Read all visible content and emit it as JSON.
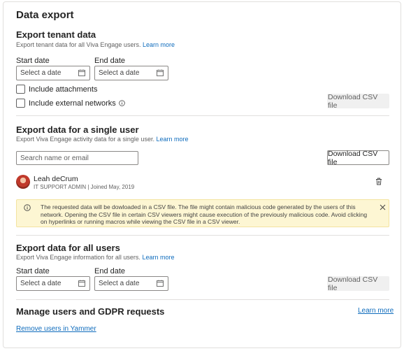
{
  "page": {
    "title": "Data export"
  },
  "tenant": {
    "heading": "Export tenant data",
    "description": "Export tenant data for all Viva Engage users.",
    "learn_more": "Learn more",
    "start_label": "Start date",
    "end_label": "End date",
    "start_placeholder": "Select a date",
    "end_placeholder": "Select a date",
    "include_attachments": "Include attachments",
    "include_external": "Include external networks",
    "download": "Download CSV file"
  },
  "single_user": {
    "heading": "Export data for a single user",
    "description": "Export Viva Engage activity data for a single user.",
    "learn_more": "Learn more",
    "search_placeholder": "Search name or email",
    "download": "Download CSV file",
    "user": {
      "name": "Leah deCrum",
      "meta": "IT SUPPORT ADMIN | Joined May, 2019"
    }
  },
  "warning": {
    "text": "The requested data will be dowloaded in a CSV file. The file might contain malicious code generated by the users of this network. Opening the CSV file in certain CSV viewers might cause execution of the previously malicious code. Avoid clicking on hyperlinks or running macros while viewing the CSV file in a CSV viewer."
  },
  "all_users": {
    "heading": "Export data for all users",
    "description": "Export Viva Engage information for all users.",
    "learn_more": "Learn more",
    "start_label": "Start date",
    "end_label": "End date",
    "start_placeholder": "Select a date",
    "end_placeholder": "Select a date",
    "download": "Download CSV file"
  },
  "gdpr": {
    "heading": "Manage users and GDPR requests",
    "learn_more": "Learn more",
    "remove_users": "Remove users in Yammer"
  },
  "colors": {
    "accent": "#0f6cbd",
    "warning_bg": "#fdf6d3"
  }
}
